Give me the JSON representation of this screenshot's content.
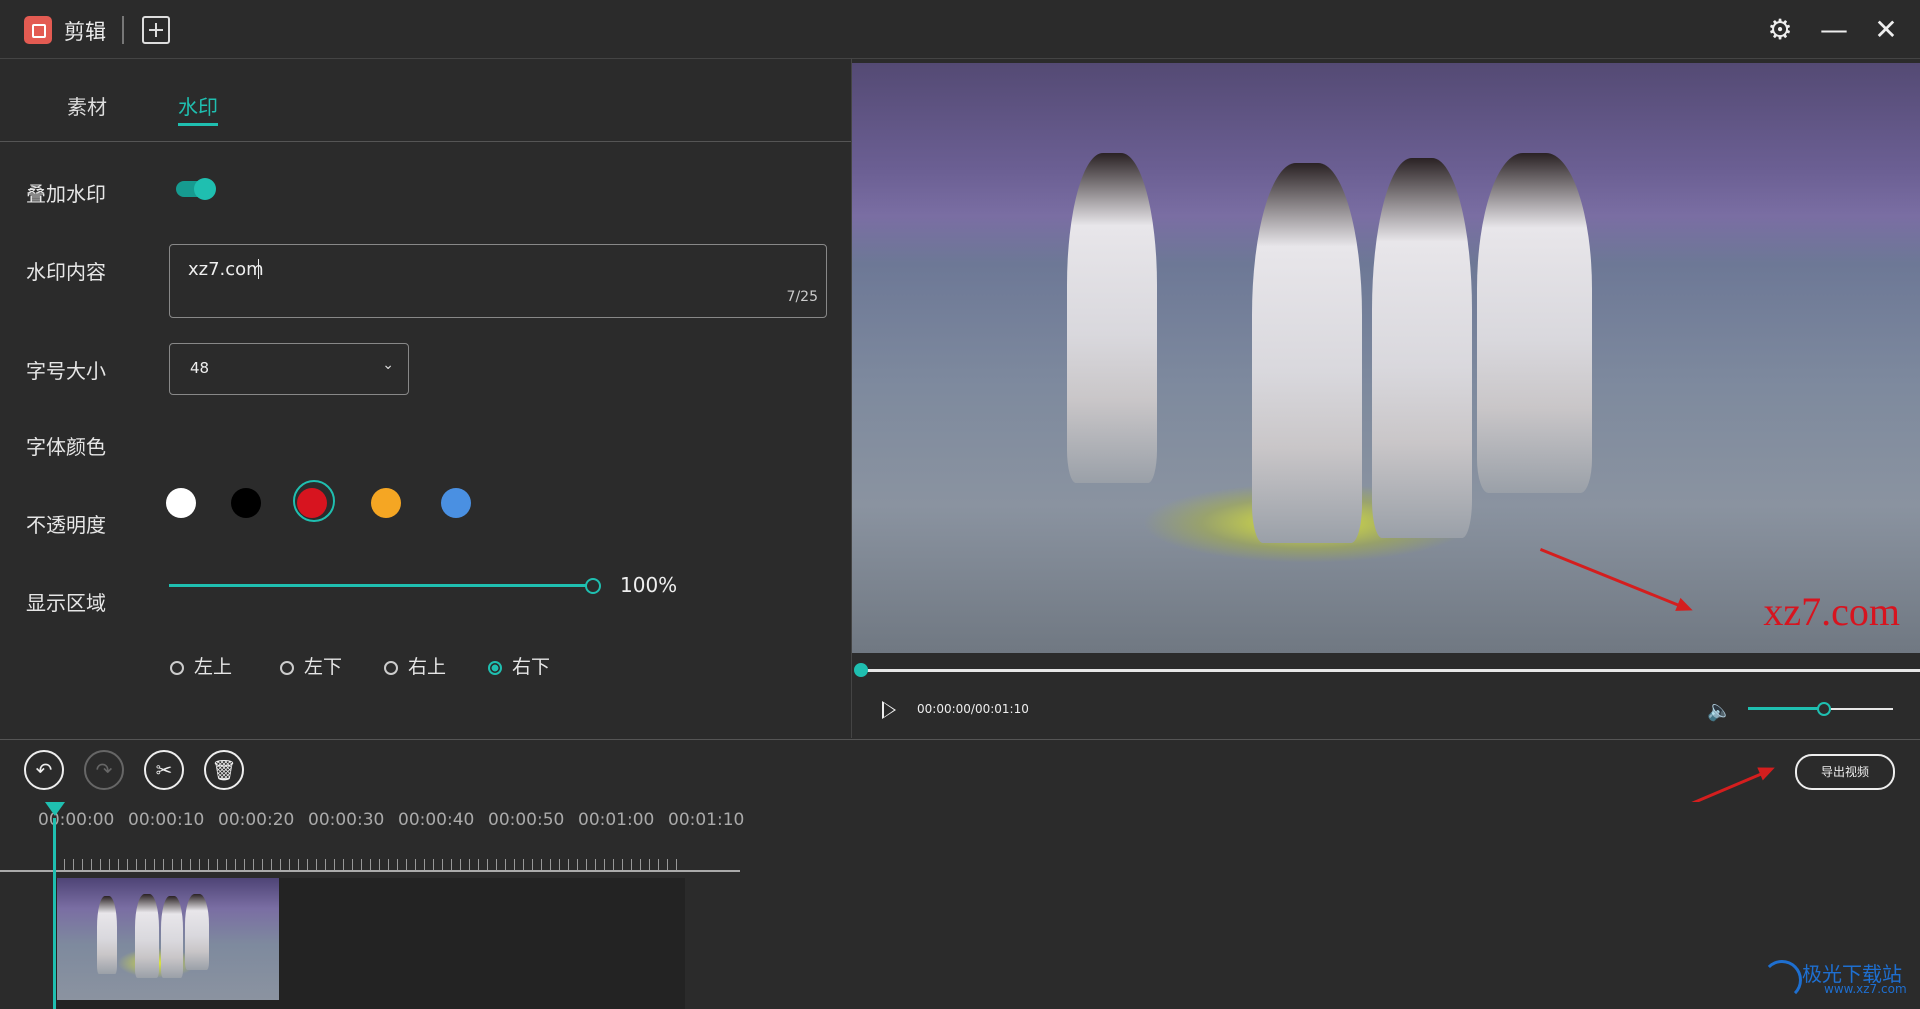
{
  "app": {
    "title": "剪辑"
  },
  "tabs": {
    "assets": "素材",
    "watermark": "水印"
  },
  "watermark_form": {
    "overlay_label": "叠加水印",
    "overlay_enabled": true,
    "content_label": "水印内容",
    "content_value": "xz7.com",
    "content_count": "7/25",
    "font_size_label": "字号大小",
    "font_size_value": "48",
    "font_color_label": "字体颜色",
    "colors": [
      "#ffffff",
      "#000000",
      "#d7141f",
      "#f5a623",
      "#4a90e2"
    ],
    "selected_color_index": 2,
    "opacity_label": "不透明度",
    "opacity_value": "100%",
    "region_label": "显示区域",
    "regions": [
      "左上",
      "左下",
      "右上",
      "右下"
    ],
    "selected_region_index": 3
  },
  "preview": {
    "watermark_text": "xz7.com",
    "watermark_color": "#d7141f",
    "time": "00:00:00/00:01:10",
    "progress": 0,
    "volume": 0.5
  },
  "toolbar": {
    "undo_icon": "undo-icon",
    "redo_icon": "redo-icon",
    "cut_icon": "scissors-icon",
    "delete_icon": "trash-icon",
    "export_label": "导出视频"
  },
  "timeline": {
    "ticks": [
      "00:00:00",
      "00:00:10",
      "00:00:20",
      "00:00:30",
      "00:00:40",
      "00:00:50",
      "00:01:00",
      "00:01:10"
    ]
  },
  "accent_color": "#1fbfb0",
  "corner_logo": {
    "name": "极光下载站",
    "url": "www.xz7.com"
  }
}
